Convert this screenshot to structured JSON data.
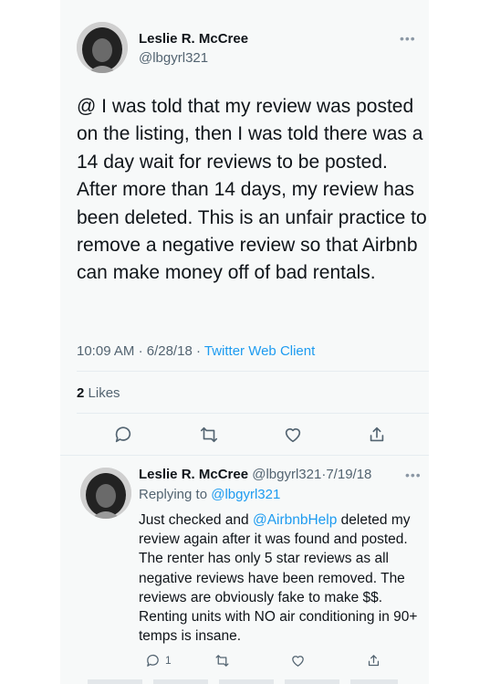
{
  "tweet": {
    "author_name": "Leslie R. McCree",
    "author_handle": "@lbgyrl321",
    "more_label": "•••",
    "text": "@ I was told that my review was posted on the listing, then I was told there was a 14 day wait for reviews to be posted. After more than 14 days, my review has been deleted. This is an unfair practice to remove a negative review so that Airbnb can make money off of bad rentals.",
    "time": "10:09 AM",
    "date": "6/28/18",
    "separator": "·",
    "client": "Twitter Web Client",
    "likes_count": "2",
    "likes_label": "Likes",
    "actions": [
      "reply-icon",
      "retweet-icon",
      "like-icon",
      "share-icon"
    ]
  },
  "reply": {
    "author_name": "Leslie R. McCree",
    "author_handle": "@lbgyrl321",
    "date": "7/19/18",
    "separator": "·",
    "more_label": "•••",
    "replying_prefix": "Replying to",
    "replying_to": "@lbgyrl321",
    "text_before": "Just checked and ",
    "mention": "@AirbnbHelp",
    "text_after": " deleted my review again after it was found and posted. The renter has only 5 star reviews as all negative reviews have been removed. The reviews are obviously fake to make $$. Renting units with NO air conditioning in 90+ temps is insane.",
    "reply_count": "1"
  },
  "colors": {
    "accent": "#1d9bf0",
    "muted": "#536471",
    "text": "#0f1419",
    "card": "#f7f9f9"
  }
}
